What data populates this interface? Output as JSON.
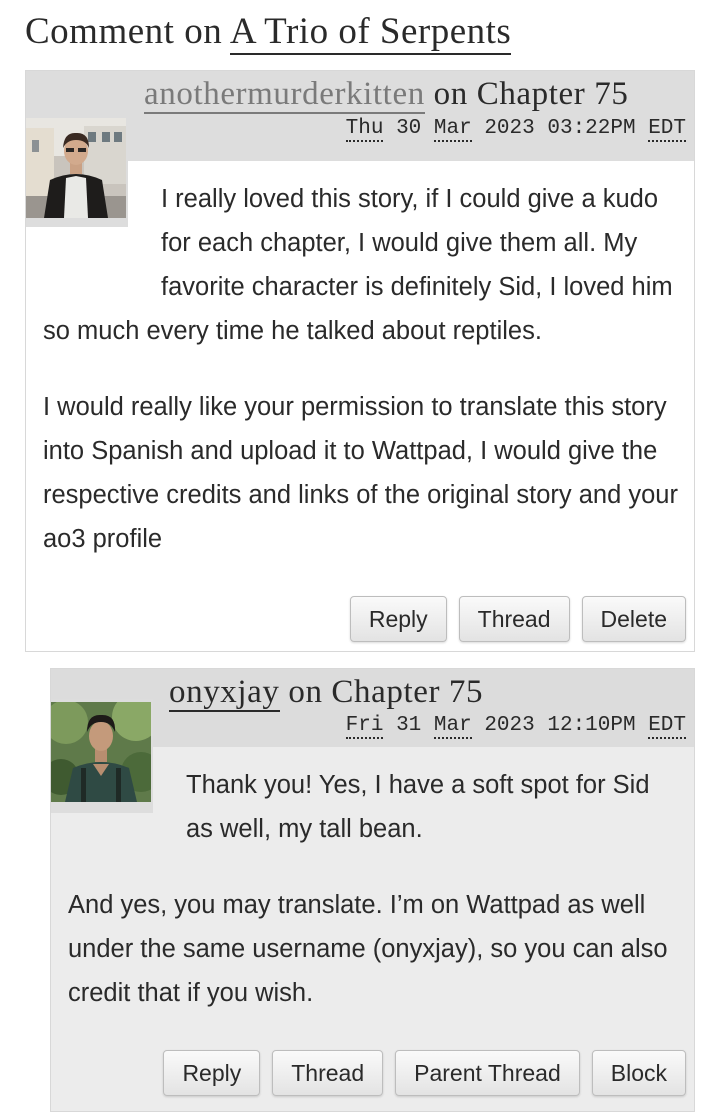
{
  "page": {
    "heading_prefix": "Comment on",
    "work_title": "A Trio of Serpents"
  },
  "comments": [
    {
      "username": "anothermurderkitten",
      "on_text": "on Chapter 75",
      "date": {
        "weekday": "Thu",
        "day": "30",
        "month": "Mar",
        "year": "2023",
        "time": "03:22PM",
        "tz": "EDT"
      },
      "avatar": "avatar-photo-man-in-leather-jacket",
      "paragraphs": [
        "I really loved this story, if I could give a kudo for each chapter, I would give them all. My favorite character is definitely Sid, I loved him so much every time he talked about reptiles.",
        "I would really like your permission to translate this story into Spanish and upload it to Wattpad, I would give the respective credits and links of the original story and your ao3 profile"
      ],
      "actions": [
        "Reply",
        "Thread",
        "Delete"
      ]
    },
    {
      "username": "onyxjay",
      "on_text": "on Chapter 75",
      "date": {
        "weekday": "Fri",
        "day": "31",
        "month": "Mar",
        "year": "2023",
        "time": "12:10PM",
        "tz": "EDT"
      },
      "avatar": "avatar-photo-man-in-green-shirt",
      "paragraphs": [
        "Thank you! Yes, I have a soft spot for Sid as well, my tall bean.",
        "And yes, you may translate. I’m on Wattpad as well under the same username (onyxjay), so you can also credit that if you wish."
      ],
      "actions": [
        "Reply",
        "Thread",
        "Parent Thread",
        "Block"
      ]
    }
  ]
}
